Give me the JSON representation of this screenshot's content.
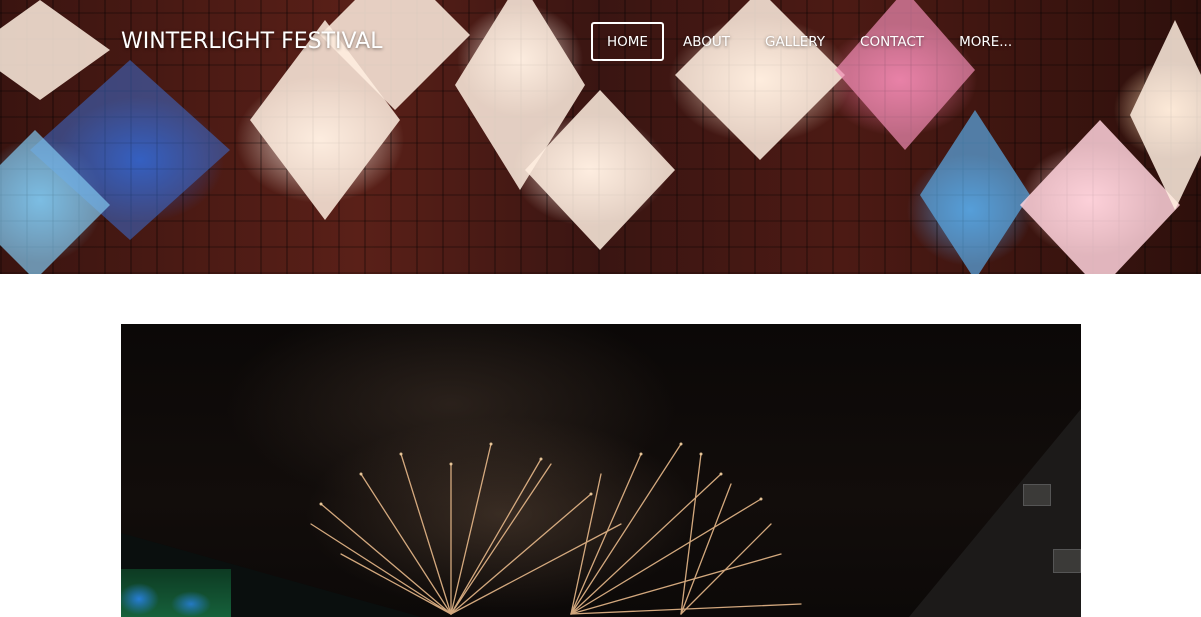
{
  "site": {
    "title": "WINTERLIGHT FESTIVAL"
  },
  "nav": {
    "items": [
      {
        "label": "HOME",
        "active": true
      },
      {
        "label": "ABOUT",
        "active": false
      },
      {
        "label": "GALLERY",
        "active": false
      },
      {
        "label": "CONTACT",
        "active": false
      },
      {
        "label": "MORE...",
        "active": false
      }
    ]
  },
  "colors": {
    "header_text": "#ffffff",
    "page_background": "#ffffff"
  }
}
